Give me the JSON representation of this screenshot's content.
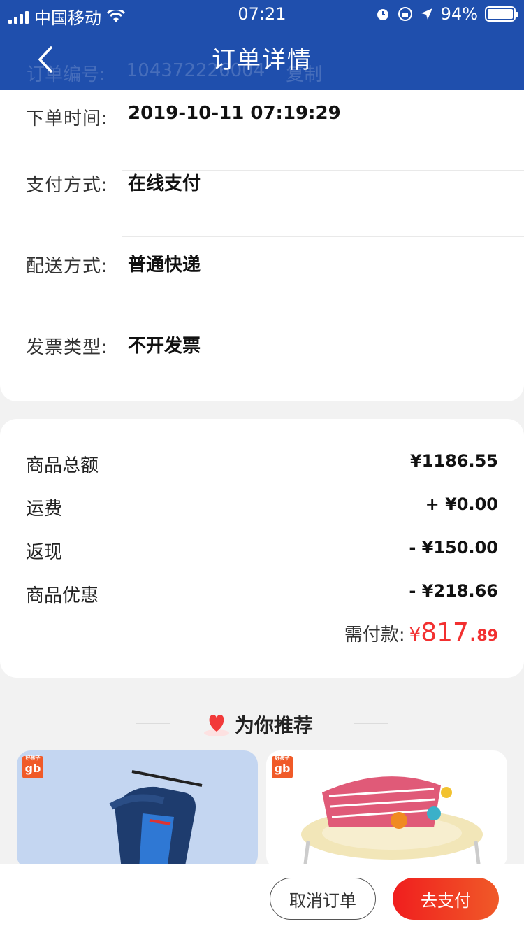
{
  "status_bar": {
    "carrier": "中国移动",
    "time": "07:21",
    "battery": "94%"
  },
  "header": {
    "title": "订单详情",
    "ghost_label": "订单编号:",
    "ghost_value": "104372226004",
    "ghost_copy": "复制"
  },
  "order_info": [
    {
      "label": "下单时间:",
      "value": "2019-10-11 07:19:29"
    },
    {
      "label": "支付方式:",
      "value": "在线支付"
    },
    {
      "label": "配送方式:",
      "value": "普通快递"
    },
    {
      "label": "发票类型:",
      "value": "不开发票"
    }
  ],
  "prices": [
    {
      "label": "商品总额",
      "value": "¥1186.55"
    },
    {
      "label": "运费",
      "value": "+ ¥0.00"
    },
    {
      "label": "返现",
      "value": "- ¥150.00"
    },
    {
      "label": "商品优惠",
      "value": "- ¥218.66"
    }
  ],
  "total": {
    "label": "需付款:",
    "yen": "¥",
    "integer": "817.",
    "decimal": "89"
  },
  "recommend": {
    "title": "为你推荐",
    "brand_text": "gb",
    "brand_small": "好孩子"
  },
  "actions": {
    "cancel": "取消订单",
    "pay": "去支付"
  },
  "colors": {
    "header": "#1f4fad",
    "accent_red": "#f23030"
  }
}
